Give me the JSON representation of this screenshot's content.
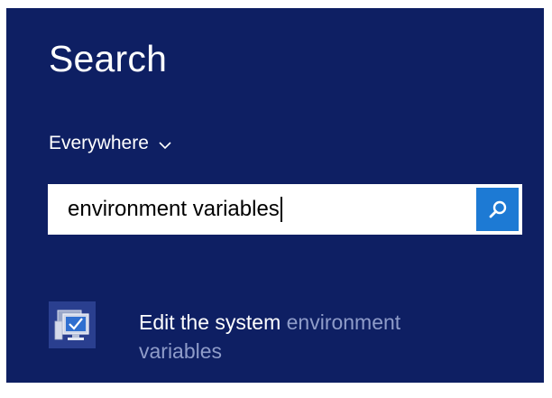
{
  "search_pane": {
    "title": "Search",
    "scope": {
      "label": "Everywhere",
      "icon": "chevron-down-icon"
    },
    "search_box": {
      "value": "environment variables",
      "button_icon": "search-icon"
    },
    "results": [
      {
        "icon": "system-monitor-icon",
        "label_highlight": "Edit the system",
        "label_match_1": " environment",
        "label_match_2": "variables"
      }
    ]
  },
  "colors": {
    "panel_background": "#0e1f63",
    "search_button": "#1d7ad4",
    "match_text": "#8f9cc9"
  }
}
